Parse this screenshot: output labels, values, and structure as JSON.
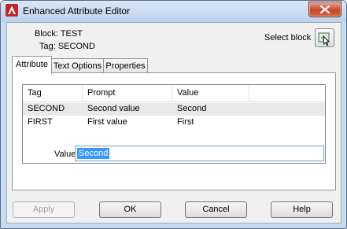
{
  "window": {
    "title": "Enhanced Attribute Editor"
  },
  "info": {
    "block": "Block: TEST",
    "tag": "Tag: SECOND",
    "select_block_label": "Select block"
  },
  "tabs": [
    {
      "label": "Attribute",
      "active": true
    },
    {
      "label": "Text Options",
      "active": false
    },
    {
      "label": "Properties",
      "active": false
    }
  ],
  "attribute_list": {
    "columns": [
      "Tag",
      "Prompt",
      "Value"
    ],
    "rows": [
      {
        "tag": "SECOND",
        "prompt": "Second value",
        "value": "Second",
        "selected": true
      },
      {
        "tag": "FIRST",
        "prompt": "First value",
        "value": "First",
        "selected": false
      }
    ]
  },
  "value_field": {
    "label": "Value:",
    "value": "Second"
  },
  "buttons": {
    "apply": "Apply",
    "ok": "OK",
    "cancel": "Cancel",
    "help": "Help"
  },
  "colors": {
    "selection": "#3399ff",
    "close_button": "#c7442a",
    "titlebar": "#c9dbee"
  },
  "icons": [
    "autocad-app-icon",
    "close-icon",
    "select-block-icon"
  ]
}
